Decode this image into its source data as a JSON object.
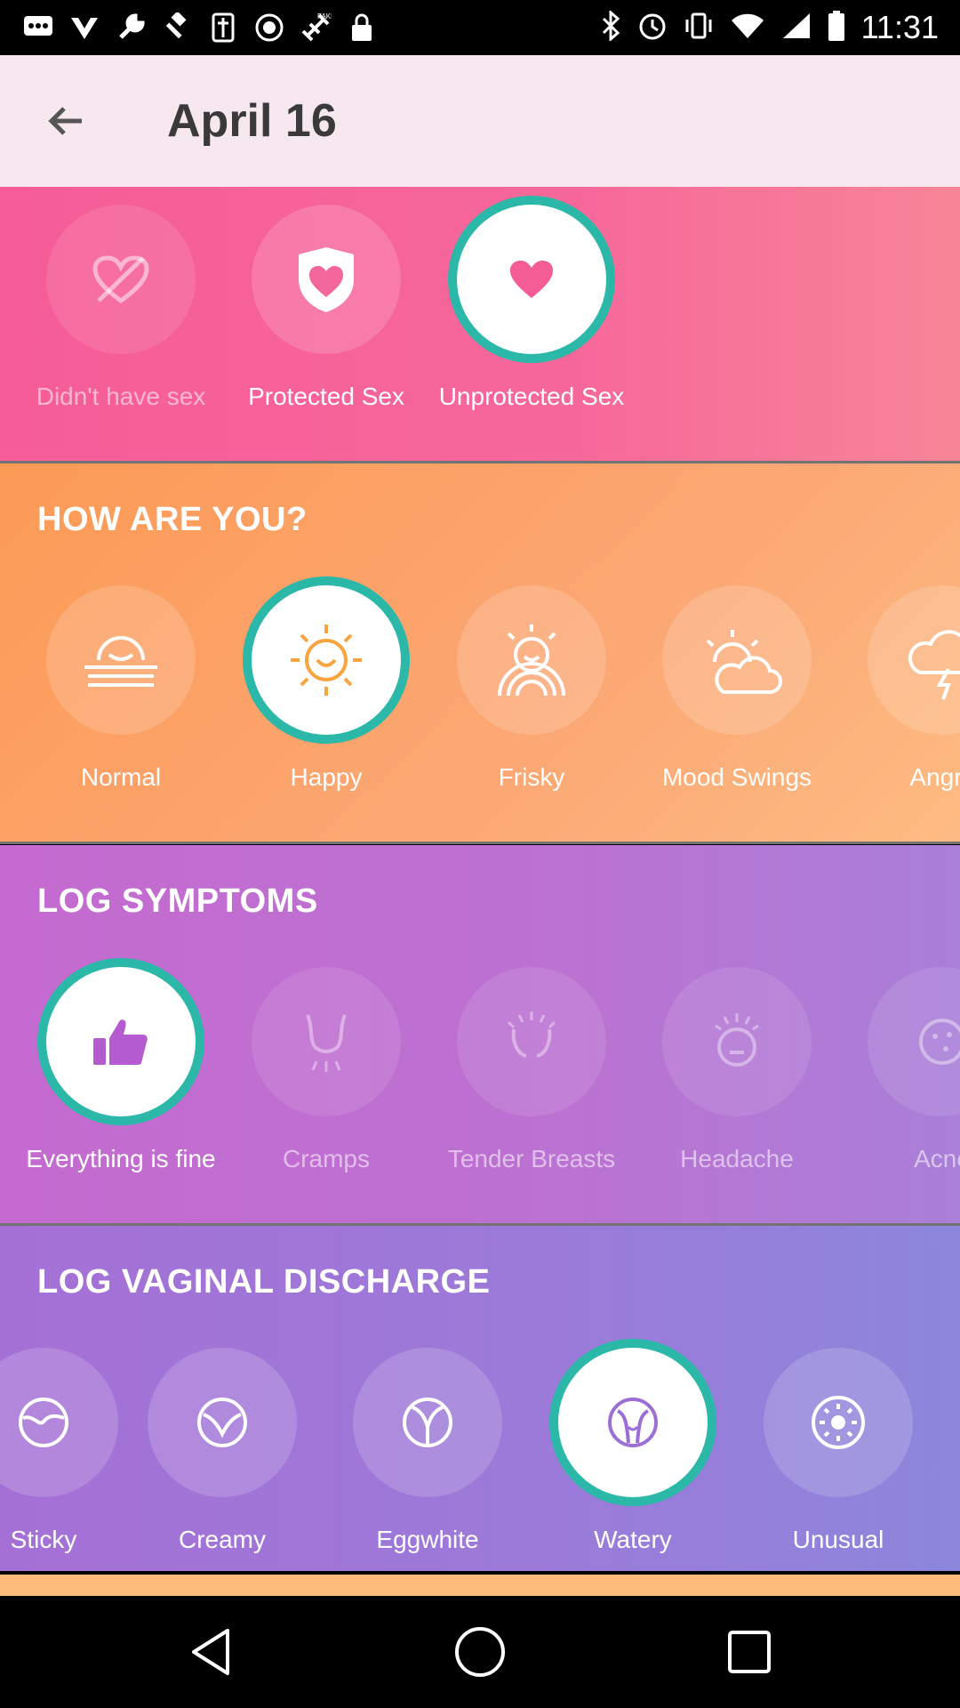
{
  "status_bar": {
    "time": "11:31",
    "left_icons": [
      "chat-icon",
      "check-icon",
      "wrench-icon",
      "gavel-icon",
      "plugin-icon",
      "block-icon",
      "fake-gps-icon",
      "lock-icon"
    ],
    "right_icons": [
      "bluetooth-icon",
      "alarm-icon",
      "vibrate-icon",
      "wifi-icon",
      "signal-icon",
      "battery-icon"
    ]
  },
  "header": {
    "title": "April 16"
  },
  "sex_section": {
    "items": [
      {
        "label": "Didn't have sex",
        "icon": "no-heart-icon",
        "state": "dim"
      },
      {
        "label": "Protected Sex",
        "icon": "shield-heart-icon",
        "state": "normal"
      },
      {
        "label": "Unprotected Sex",
        "icon": "heart-icon",
        "state": "selected"
      }
    ]
  },
  "mood_section": {
    "title": "HOW ARE YOU?",
    "items": [
      {
        "label": "Normal",
        "icon": "sun-horizon-icon",
        "state": "normal"
      },
      {
        "label": "Happy",
        "icon": "smiling-sun-icon",
        "state": "selected"
      },
      {
        "label": "Frisky",
        "icon": "rainbow-sun-icon",
        "state": "normal"
      },
      {
        "label": "Mood Swings",
        "icon": "sun-cloud-icon",
        "state": "normal"
      },
      {
        "label": "Angry",
        "icon": "storm-cloud-icon",
        "state": "normal"
      }
    ]
  },
  "symptoms_section": {
    "title": "LOG SYMPTOMS",
    "items": [
      {
        "label": "Everything is fine",
        "icon": "thumbs-up-icon",
        "state": "selected"
      },
      {
        "label": "Cramps",
        "icon": "cramps-icon",
        "state": "dim"
      },
      {
        "label": "Tender Breasts",
        "icon": "tender-breasts-icon",
        "state": "dim"
      },
      {
        "label": "Headache",
        "icon": "headache-icon",
        "state": "dim"
      },
      {
        "label": "Acne",
        "icon": "acne-icon",
        "state": "dim"
      }
    ]
  },
  "discharge_section": {
    "title": "LOG VAGINAL DISCHARGE",
    "items": [
      {
        "label": "Sticky",
        "icon": "sticky-icon",
        "state": "normal"
      },
      {
        "label": "Creamy",
        "icon": "creamy-icon",
        "state": "normal"
      },
      {
        "label": "Eggwhite",
        "icon": "eggwhite-icon",
        "state": "normal"
      },
      {
        "label": "Watery",
        "icon": "watery-icon",
        "state": "selected"
      },
      {
        "label": "Unusual",
        "icon": "unusual-icon",
        "state": "normal"
      }
    ]
  },
  "nav_bar": {
    "buttons": [
      "back-triangle-icon",
      "home-circle-icon",
      "recents-square-icon"
    ]
  },
  "colors": {
    "selected_ring": "#2bb8a8",
    "sex_gradient": "#f55c98",
    "mood_gradient": "#fc9a56",
    "symptoms_gradient": "#c56ad0",
    "discharge_gradient": "#a570d6"
  }
}
